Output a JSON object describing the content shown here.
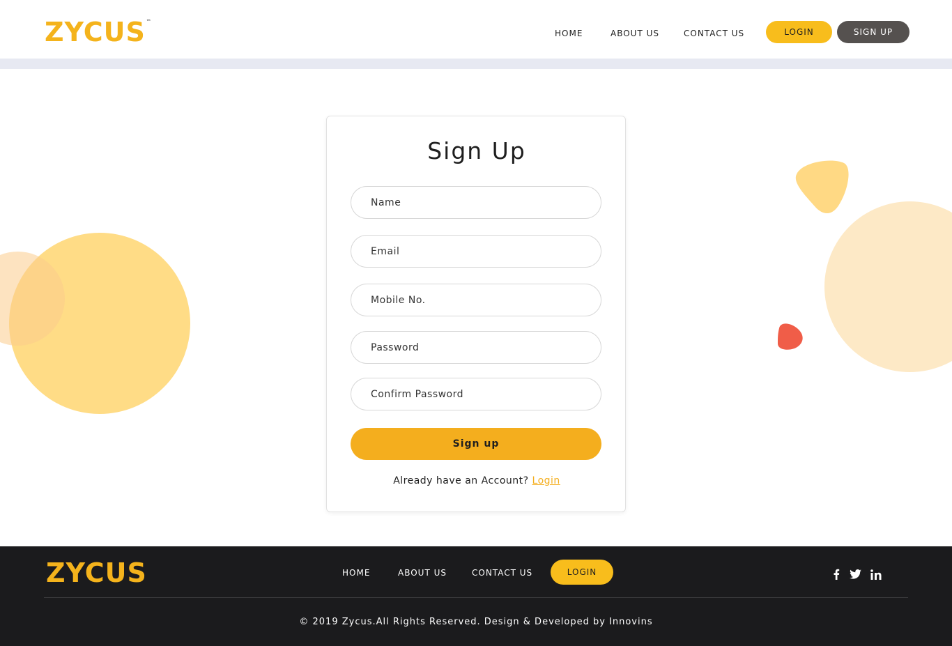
{
  "brand": {
    "logo_text": "ZYCUS",
    "trademark": "™",
    "accent_color": "#f4ae1e",
    "dark_color": "#55514f"
  },
  "header": {
    "nav": [
      "HOME",
      "ABOUT US",
      "CONTACT US"
    ],
    "login_label": "LOGIN",
    "signup_label": "SIGN UP"
  },
  "form": {
    "title": "Sign Up",
    "fields": [
      {
        "placeholder": "Name",
        "value": ""
      },
      {
        "placeholder": "Email",
        "value": ""
      },
      {
        "placeholder": "Mobile No.",
        "value": ""
      },
      {
        "placeholder": "Password",
        "value": ""
      },
      {
        "placeholder": "Confirm Password",
        "value": ""
      }
    ],
    "submit_label": "Sign up",
    "already_text": "Already have an Account?",
    "login_link": "Login"
  },
  "footer": {
    "logo_text": "ZYCUS",
    "nav": [
      "HOME",
      "ABOUT US",
      "CONTACT US"
    ],
    "login_label": "LOGIN",
    "social_icons": [
      "facebook-icon",
      "twitter-icon",
      "linkedin-icon"
    ],
    "copyright": "© 2019 Zycus.All Rights Reserved. Design & Developed by Innovins"
  }
}
